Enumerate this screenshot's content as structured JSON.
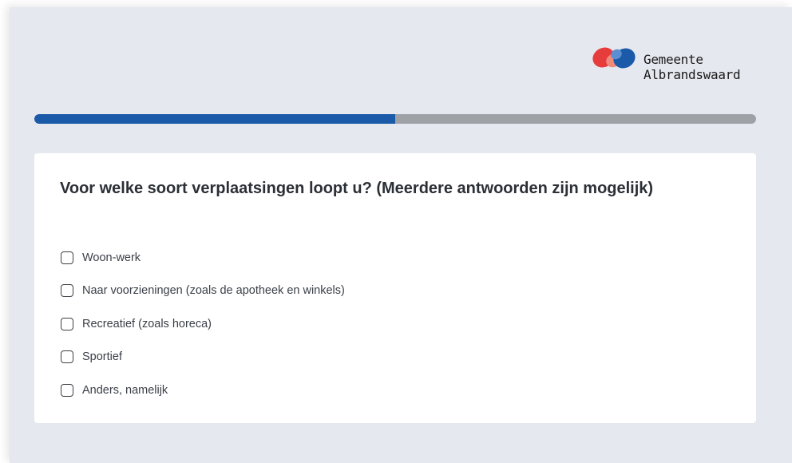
{
  "brand": {
    "logo_line1": "Gemeente",
    "logo_line2": "Albrandswaard",
    "logo_colors": [
      "#e63c3c",
      "#f08a7a",
      "#1b5aa8",
      "#5b8fd1"
    ]
  },
  "progress": {
    "value_fraction": 0.5,
    "fill_color": "#1b5aa8",
    "track_color": "#9ea2a6"
  },
  "question": {
    "text": "Voor welke soort verplaatsingen loopt u? (Meerdere antwoorden zijn mogelijk)",
    "options": [
      {
        "label": "Woon-werk",
        "checked": false
      },
      {
        "label": "Naar voorzieningen (zoals de apotheek en winkels)",
        "checked": false
      },
      {
        "label": "Recreatief (zoals horeca)",
        "checked": false
      },
      {
        "label": "Sportief",
        "checked": false
      },
      {
        "label": "Anders, namelijk",
        "checked": false
      }
    ]
  }
}
